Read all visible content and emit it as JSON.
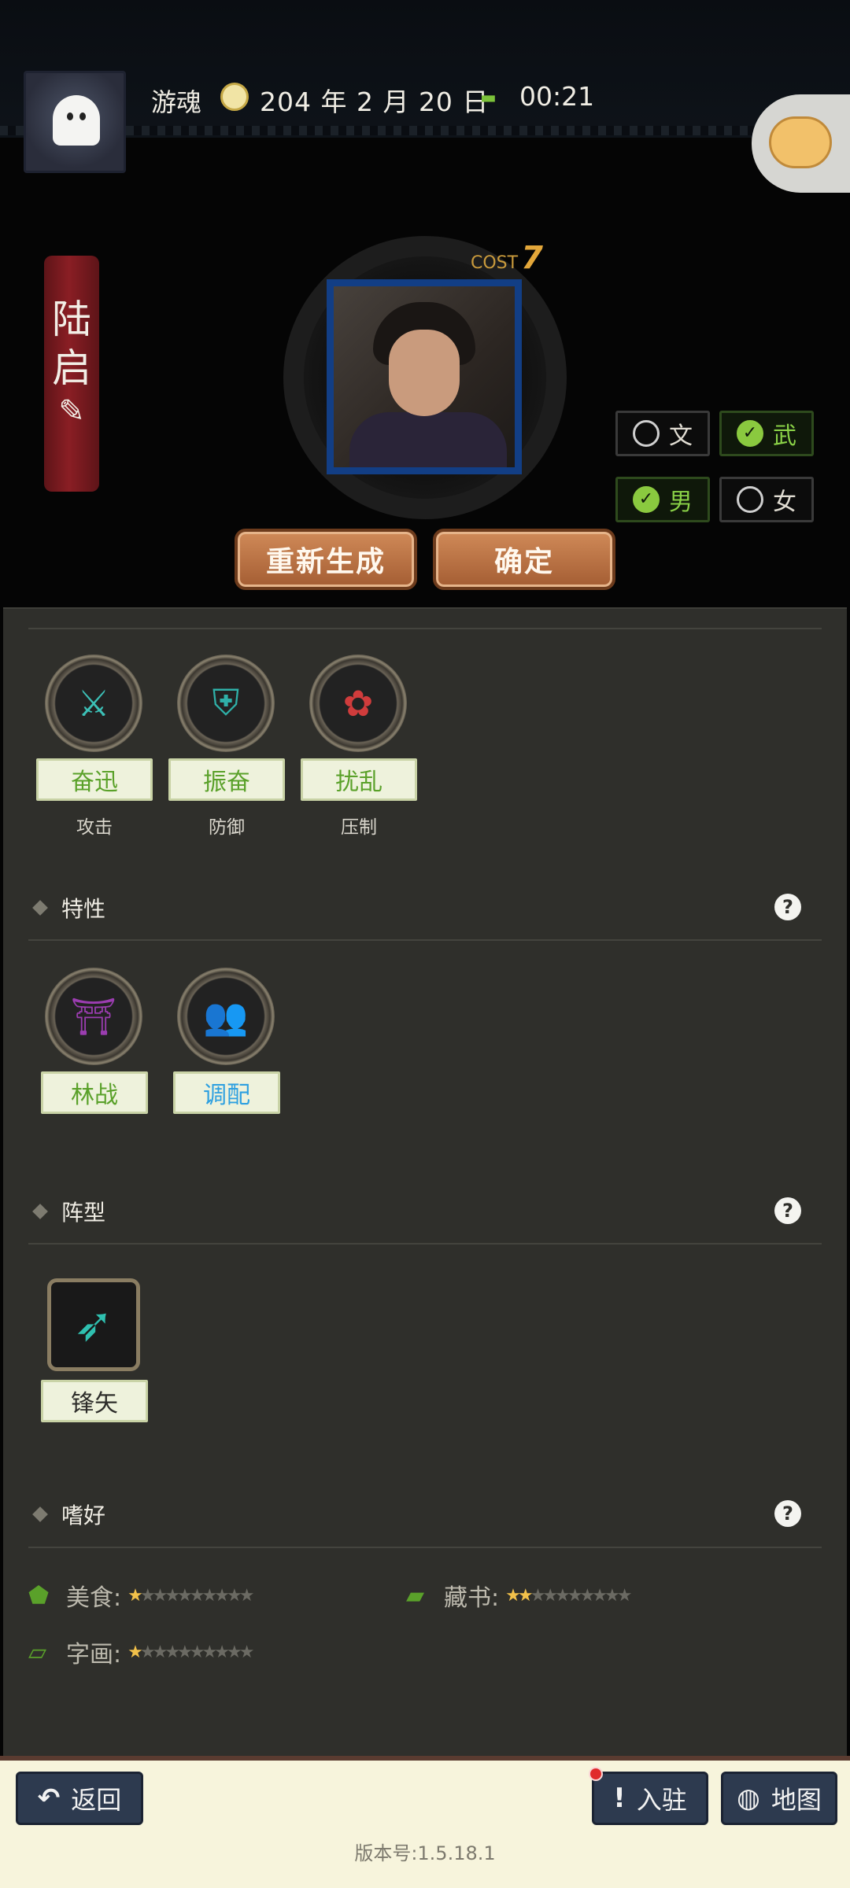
{
  "header": {
    "player_name": "游魂",
    "date": "204 年 2 月 20 日",
    "time": "00:21"
  },
  "hero": {
    "name_char1": "陆",
    "name_char2": "启",
    "cost_label": "COST",
    "cost_value": "7"
  },
  "options": {
    "wen": "文",
    "wu": "武",
    "male": "男",
    "female": "女"
  },
  "actions": {
    "regenerate": "重新生成",
    "confirm": "确定"
  },
  "skills": [
    {
      "label": "奋迅",
      "type": "攻击",
      "icon": "crossed-swords-icon",
      "color": "#3cc0b7"
    },
    {
      "label": "振奋",
      "type": "防御",
      "icon": "shield-banner-icon",
      "color": "#2fb0a8"
    },
    {
      "label": "扰乱",
      "type": "压制",
      "icon": "chaos-cloud-icon",
      "color": "#d03c3c"
    }
  ],
  "traits": {
    "title": "特性",
    "items": [
      {
        "label": "林战",
        "icon": "forest-gate-icon",
        "color": "#9b3db0"
      },
      {
        "label": "调配",
        "icon": "people-idea-icon",
        "color": "#d040a0"
      }
    ]
  },
  "formation": {
    "title": "阵型",
    "label": "锋矢"
  },
  "hobbies": {
    "title": "嗜好",
    "items": [
      {
        "label": "美食:",
        "stars": 1,
        "max": 10,
        "icon": "food-icon"
      },
      {
        "label": "藏书:",
        "stars": 2,
        "max": 10,
        "icon": "book-icon"
      },
      {
        "label": "字画:",
        "stars": 1,
        "max": 10,
        "icon": "painting-icon"
      }
    ]
  },
  "bottom": {
    "back": "返回",
    "station": "入驻",
    "map": "地图",
    "version": "版本号:1.5.18.1"
  },
  "help_glyph": "?"
}
